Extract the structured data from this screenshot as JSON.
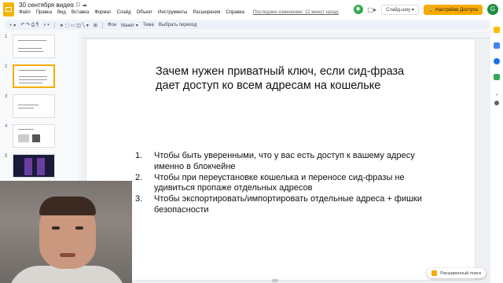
{
  "app": {
    "title": "30 сентября видео",
    "title_icons": "☆ ⊡ ☁",
    "menu": [
      "Файл",
      "Правка",
      "Вид",
      "Вставка",
      "Формат",
      "Слайд",
      "Объект",
      "Инструменты",
      "Расширения",
      "Справка"
    ],
    "last_edit": "Последнее изменение: 12 минут назад",
    "present_label": "Слайд-шоу ▾",
    "share_label": "🔒 Настройки Доступа",
    "avatar_letter": "G",
    "meet_icon": "◉",
    "camera_icon": "▢▸"
  },
  "toolbar": {
    "new_slide": "+ ▾",
    "undo_redo": "↶ ↷ ⎙ ¶",
    "zoom": "⌕ ▾",
    "tools": "➤ ⬚ ▭ ◫ ╲ ▾",
    "comment": "⊞",
    "background": "Фон",
    "layout": "Макет ▾",
    "theme": "Тема",
    "transition": "Выбрать переход"
  },
  "slides_panel": {
    "numbers": [
      "1",
      "2",
      "3",
      "4",
      "5"
    ],
    "selected_index": 2
  },
  "slide": {
    "heading": "Зачем нужен приватный ключ, если сид-фраза дает доступ ко всем адресам на кошельке",
    "items": [
      {
        "num": "1.",
        "text": "Чтобы быть уверенными, что у вас есть доступ к вашему адресу именно в блокчейне"
      },
      {
        "num": "2.",
        "text": "Чтобы при переустановке кошелька и переносе сид-фразы не удивиться пропаже отдельных адресов"
      },
      {
        "num": "3.",
        "text": "Чтобы экспортировать/импортировать отдельные адреса + фишки безопасности"
      }
    ]
  },
  "explore": {
    "label": "Расширенный поиск"
  },
  "colors": {
    "accent": "#f9ab00",
    "meet": "#34a853",
    "avatar": "#1e8e3e"
  }
}
